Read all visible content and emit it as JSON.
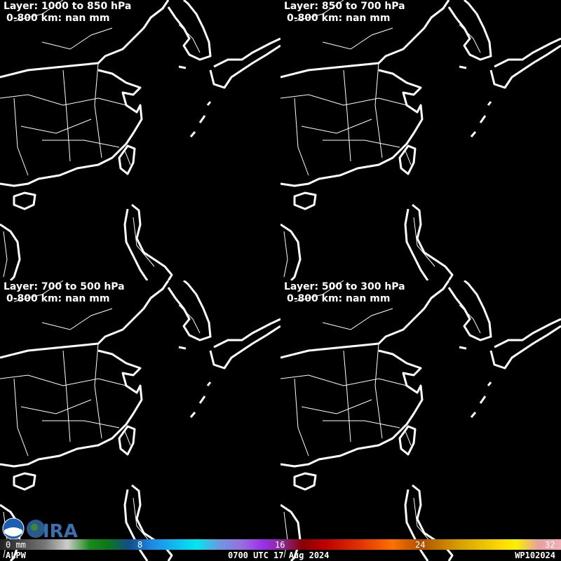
{
  "panels": [
    {
      "layer": "Layer: 1000 to 850 hPa",
      "stat": "0-800 km: nan mm"
    },
    {
      "layer": "Layer: 850 to 700 hPa",
      "stat": "0-800 km: nan mm"
    },
    {
      "layer": "Layer: 700 to 500 hPa",
      "stat": "0-800 km: nan mm"
    },
    {
      "layer": "Layer: 500 to 300 hPa",
      "stat": "0-800 km: nan mm"
    }
  ],
  "colorbar": {
    "ticks": [
      "0 mm",
      "8",
      "16",
      "24",
      "32"
    ],
    "range": [
      0,
      32
    ],
    "unit": "mm"
  },
  "footer": {
    "product": "ALPW",
    "time": "0700 UTC 17 Aug 2024",
    "storm": "WP102024"
  },
  "logos": {
    "noaa": "NOAA",
    "cira": "CIRA"
  }
}
